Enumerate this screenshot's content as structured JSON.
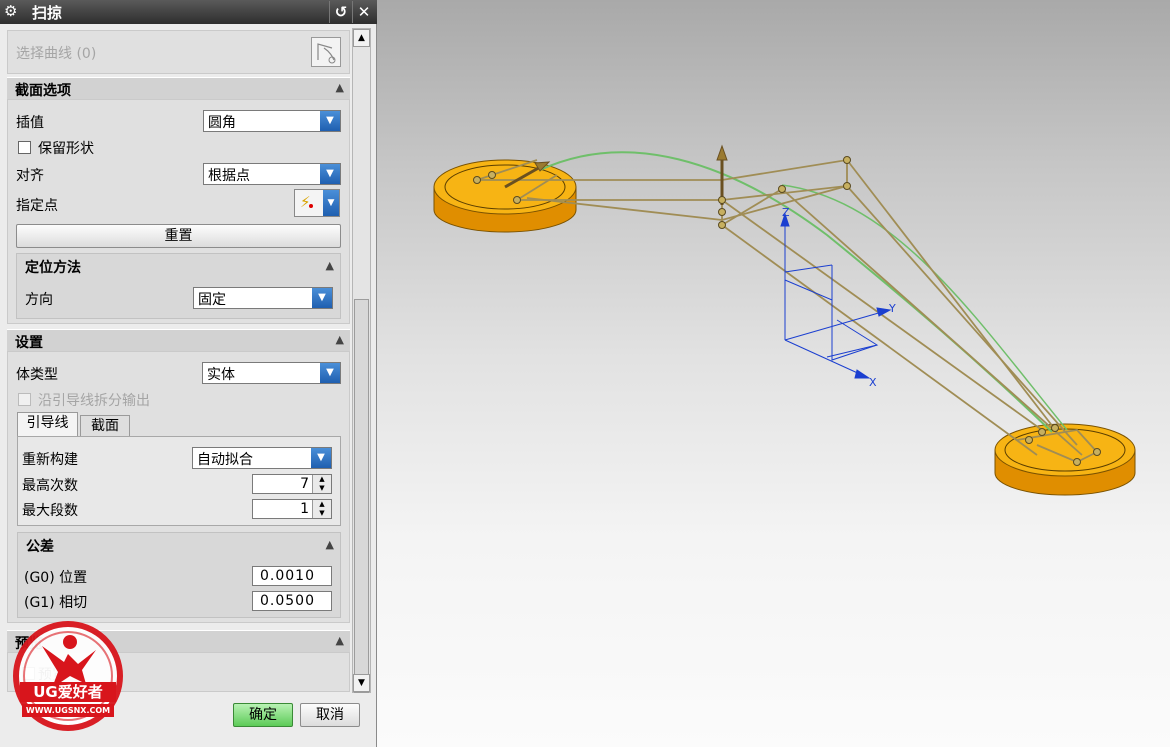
{
  "dialog": {
    "title": "扫掠",
    "select_curve": "选择曲线 (0)",
    "section_options": {
      "heading": "截面选项",
      "interpolation_label": "插值",
      "interpolation_value": "圆角",
      "keep_shape_label": "保留形状",
      "align_label": "对齐",
      "align_value": "根据点",
      "specify_point_label": "指定点",
      "reset_button": "重置",
      "orientation": {
        "heading": "定位方法",
        "direction_label": "方向",
        "direction_value": "固定"
      }
    },
    "settings": {
      "heading": "设置",
      "body_type_label": "体类型",
      "body_type_value": "实体",
      "split_output_label": "沿引导线拆分输出",
      "tabs": [
        "引导线",
        "截面"
      ],
      "rebuild_label": "重新构建",
      "rebuild_value": "自动拟合",
      "max_degree_label": "最高次数",
      "max_degree_value": "7",
      "max_segments_label": "最大段数",
      "max_segments_value": "1",
      "tolerance": {
        "heading": "公差",
        "g0_label": "(G0) 位置",
        "g0_value": "0.0010",
        "g1_label": "(G1) 相切",
        "g1_value": "0.0500"
      }
    },
    "preview": {
      "heading": "预览",
      "checkbox_label": "预览"
    },
    "ok_button": "确定",
    "cancel_button": "取消"
  },
  "viewport": {
    "axis_labels": {
      "x": "X",
      "y": "Y",
      "z": "Z"
    },
    "colors": {
      "disc": "#f5a800",
      "guide_curve": "#6fbf6a",
      "lines": "#a08d55"
    }
  },
  "watermark": {
    "brand": "UG爱好者",
    "url": "WWW.UGSNX.COM"
  }
}
